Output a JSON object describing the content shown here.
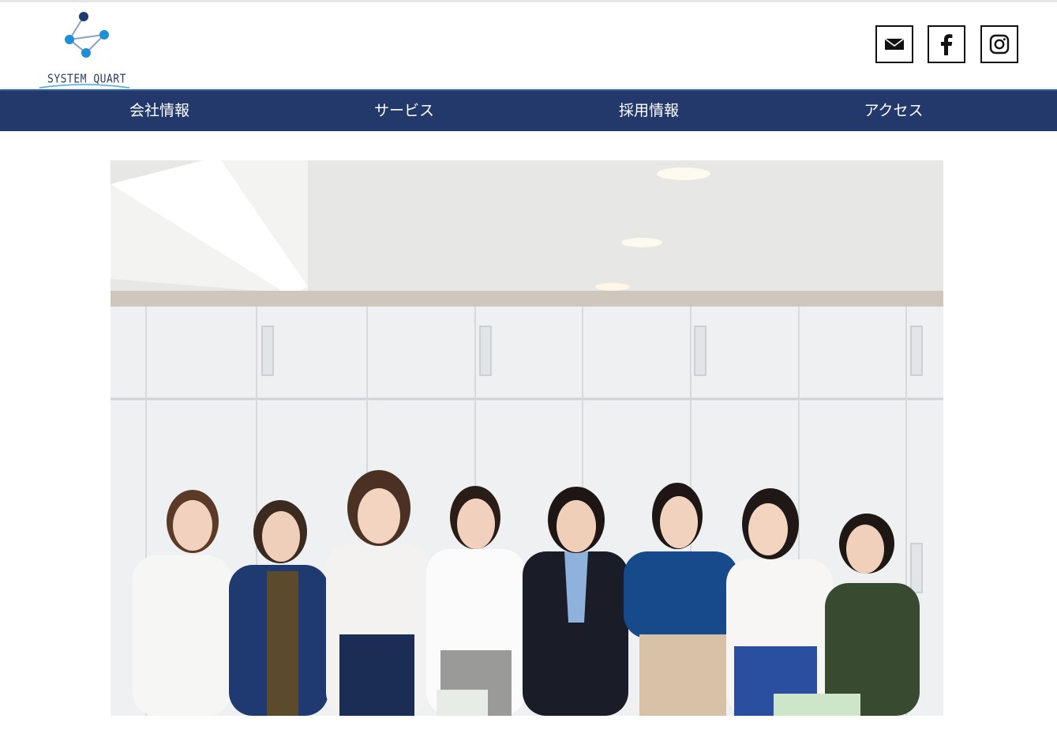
{
  "brand": {
    "name": "SYSTEM QUART",
    "accent": "#23386b",
    "dot_dark": "#1f3a6e",
    "dot_light": "#1f8fd6"
  },
  "social": [
    {
      "name": "mail-icon"
    },
    {
      "name": "facebook-icon"
    },
    {
      "name": "instagram-icon"
    }
  ],
  "nav": {
    "items": [
      {
        "label": "会社情報"
      },
      {
        "label": "サービス"
      },
      {
        "label": "採用情報"
      },
      {
        "label": "アクセス"
      }
    ]
  },
  "hero": {
    "subject": "group-photo-women-staff"
  }
}
